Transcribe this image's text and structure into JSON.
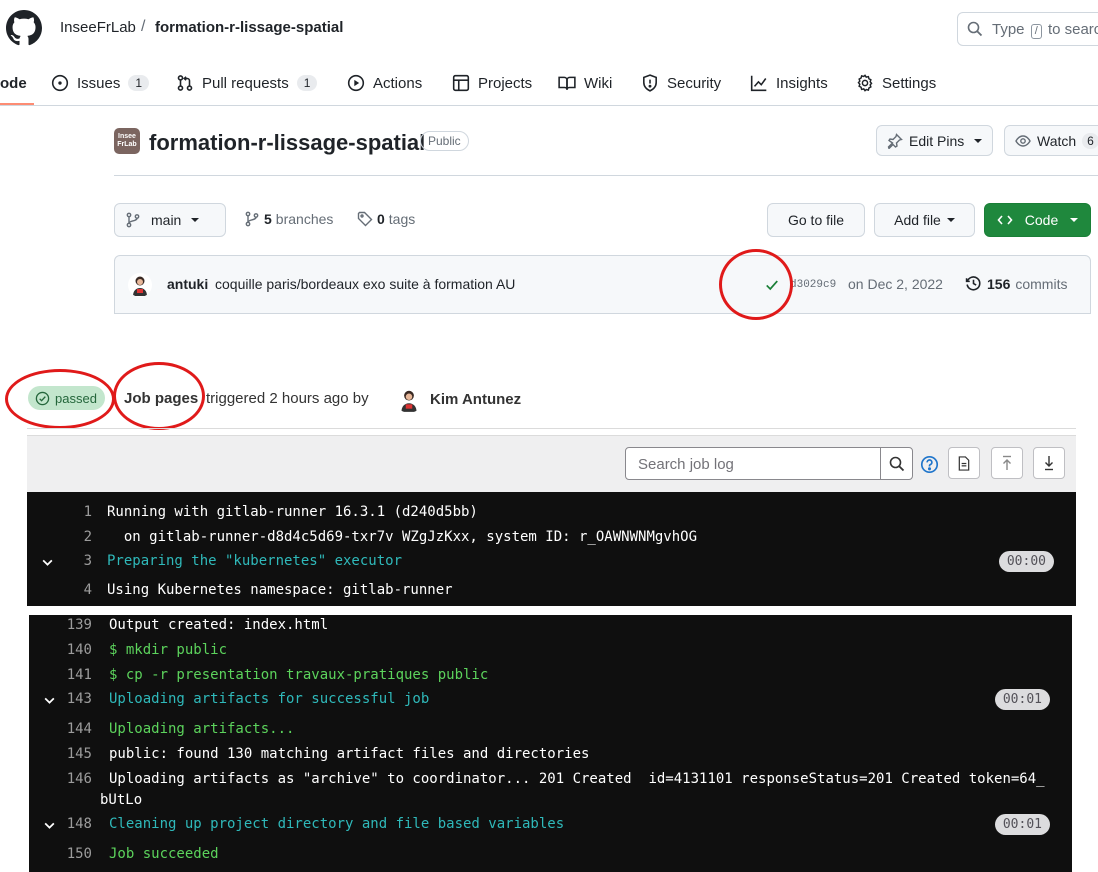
{
  "header": {
    "owner": "InseeFrLab",
    "separator": "/",
    "repo": "formation-r-lissage-spatial",
    "search_placeholder_pre": "Type",
    "search_key": "/",
    "search_placeholder_post": "to search"
  },
  "nav": {
    "code": "ode",
    "issues": "Issues",
    "issues_count": "1",
    "pulls": "Pull requests",
    "pulls_count": "1",
    "actions": "Actions",
    "projects": "Projects",
    "wiki": "Wiki",
    "security": "Security",
    "insights": "Insights",
    "settings": "Settings"
  },
  "repo_header": {
    "logo_text_top": "Insee",
    "logo_text_bottom": "FrLab",
    "title": "formation-r-lissage-spatial",
    "visibility": "Public",
    "edit_pins": "Edit Pins",
    "watch": "Watch",
    "watch_count": "6"
  },
  "branch_bar": {
    "branch": "main",
    "branches_count": "5",
    "branches_label": "branches",
    "tags_count": "0",
    "tags_label": "tags",
    "go_to_file": "Go to file",
    "add_file": "Add file",
    "code": "Code"
  },
  "commit": {
    "author": "antuki",
    "message": "coquille paris/bordeaux exo suite à formation AU",
    "sha": "d3029c9",
    "date": "on Dec 2, 2022",
    "commits_count": "156",
    "commits_label": "commits"
  },
  "job": {
    "status": "passed",
    "name": "Job pages",
    "triggered": "triggered 2 hours ago by",
    "user": "Kim Antunez",
    "search_placeholder": "Search job log"
  },
  "log_top": [
    {
      "n": "1",
      "text": "Running with gitlab-runner 16.3.1 (d240d5bb)",
      "color": "white"
    },
    {
      "n": "2",
      "text": "  on gitlab-runner-d8d4c5d69-txr7v WZgJzKxx, system ID: r_OAWNWNMgvhOG",
      "color": "white"
    },
    {
      "n": "3",
      "text": "Preparing the \"kubernetes\" executor",
      "color": "cyan",
      "time": "00:00"
    },
    {
      "n": "4",
      "text": "Using Kubernetes namespace: gitlab-runner",
      "color": "white"
    }
  ],
  "log_bottom": [
    {
      "n": "139",
      "text": "Output created: index.html",
      "color": "white"
    },
    {
      "n": "140",
      "text": "$ mkdir public",
      "color": "green"
    },
    {
      "n": "141",
      "text": "$ cp -r presentation travaux-pratiques public",
      "color": "green"
    },
    {
      "n": "143",
      "text": "Uploading artifacts for successful job",
      "color": "cyan",
      "time": "00:01"
    },
    {
      "n": "144",
      "text": "Uploading artifacts...",
      "color": "green"
    },
    {
      "n": "145",
      "text": "public: found 130 matching artifact files and directories",
      "color": "white"
    },
    {
      "n": "146",
      "text": "Uploading artifacts as \"archive\" to coordinator... 201 Created  id=4131101 responseStatus=201 Created token=64_",
      "color": "white"
    },
    {
      "n": "",
      "text": "bUtLo",
      "color": "white"
    },
    {
      "n": "148",
      "text": "Cleaning up project directory and file based variables",
      "color": "cyan",
      "time": "00:01"
    },
    {
      "n": "150",
      "text": "Job succeeded",
      "color": "green"
    }
  ],
  "colors": {
    "accent_green": "#1f883d",
    "annotation_red": "#e01a1a",
    "log_bg": "#0f0f0f",
    "log_green": "#5cd35c",
    "log_cyan": "#2fb9ba"
  },
  "icons": [
    "github-logo-icon",
    "search-icon",
    "issues-icon",
    "pull-request-icon",
    "actions-icon",
    "projects-icon",
    "wiki-icon",
    "security-icon",
    "insights-icon",
    "settings-icon",
    "pin-icon",
    "eye-icon",
    "branch-icon",
    "tag-icon",
    "code-icon",
    "check-icon",
    "history-icon",
    "check-circle-icon",
    "help-icon",
    "document-icon",
    "scroll-top-icon",
    "scroll-bottom-icon",
    "chevron-down-icon"
  ]
}
